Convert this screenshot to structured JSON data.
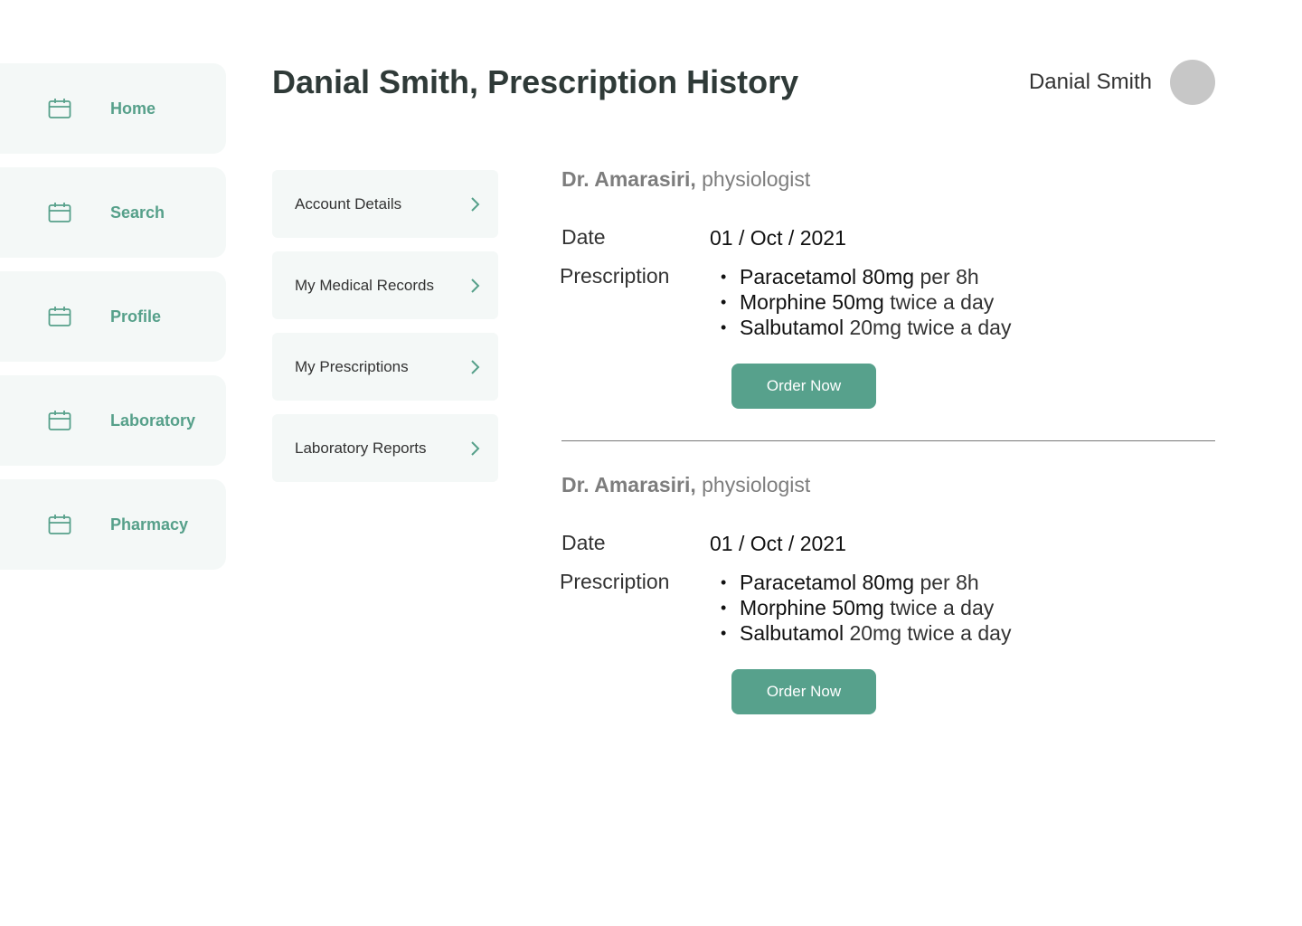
{
  "sidebar": {
    "items": [
      {
        "label": "Home",
        "icon": "calendar-icon"
      },
      {
        "label": "Search",
        "icon": "calendar-icon"
      },
      {
        "label": "Profile",
        "icon": "calendar-icon"
      },
      {
        "label": "Laboratory",
        "icon": "calendar-icon"
      },
      {
        "label": "Pharmacy",
        "icon": "calendar-icon"
      }
    ]
  },
  "header": {
    "title_name": "Danial Smith,",
    "title_page": "Prescription History",
    "user_name": "Danial Smith"
  },
  "subnav": {
    "items": [
      {
        "label": "Account Details"
      },
      {
        "label": "My Medical Records"
      },
      {
        "label": "My Prescriptions"
      },
      {
        "label": "Laboratory Reports"
      }
    ]
  },
  "records": [
    {
      "doctor_name": "Dr. Amarasiri,",
      "doctor_role": "physiologist",
      "date_label": "Date",
      "date_value": "01 / Oct / 2021",
      "prescription_label": "Prescription",
      "meds": [
        {
          "name": "Paracetamol 80mg",
          "dose": "per 8h"
        },
        {
          "name": "Morphine 50mg",
          "dose": "twice a day"
        },
        {
          "name": "Salbutamol",
          "dose": "20mg twice a day"
        }
      ],
      "order_label": "Order Now"
    },
    {
      "doctor_name": "Dr. Amarasiri,",
      "doctor_role": "physiologist",
      "date_label": "Date",
      "date_value": "01 / Oct / 2021",
      "prescription_label": "Prescription",
      "meds": [
        {
          "name": "Paracetamol 80mg",
          "dose": "per 8h"
        },
        {
          "name": "Morphine 50mg",
          "dose": "twice a day"
        },
        {
          "name": "Salbutamol",
          "dose": "20mg twice a day"
        }
      ],
      "order_label": "Order Now"
    }
  ],
  "colors": {
    "accent": "#57a18c",
    "panel_bg": "#f4f8f7",
    "avatar": "#c7c7c7"
  }
}
